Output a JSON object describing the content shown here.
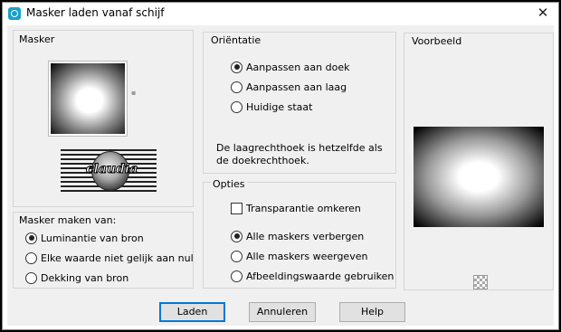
{
  "window": {
    "title": "Masker laden vanaf schijf",
    "close_symbol": "✕"
  },
  "masker": {
    "title": "Masker",
    "logo_text": "claudia"
  },
  "source": {
    "title": "Masker maken van:",
    "options": [
      {
        "label": "Luminantie van bron",
        "selected": true
      },
      {
        "label": "Elke waarde niet gelijk aan nul",
        "selected": false
      },
      {
        "label": "Dekking van bron",
        "selected": false
      }
    ]
  },
  "orientation": {
    "title": "Oriëntatie",
    "options": [
      {
        "label": "Aanpassen aan doek",
        "selected": true
      },
      {
        "label": "Aanpassen aan laag",
        "selected": false
      },
      {
        "label": "Huidige staat",
        "selected": false
      }
    ],
    "note": "De laagrechthoek is hetzelfde als de doekrechthoek."
  },
  "options": {
    "title": "Opties",
    "invert_label": "Transparantie omkeren",
    "invert_checked": false,
    "radios": [
      {
        "label": "Alle maskers verbergen",
        "selected": true
      },
      {
        "label": "Alle maskers weergeven",
        "selected": false
      },
      {
        "label": "Afbeeldingswaarde gebruiken",
        "selected": false
      }
    ]
  },
  "preview": {
    "title": "Voorbeeld"
  },
  "buttons": {
    "load": "Laden",
    "cancel": "Annuleren",
    "help": "Help"
  }
}
